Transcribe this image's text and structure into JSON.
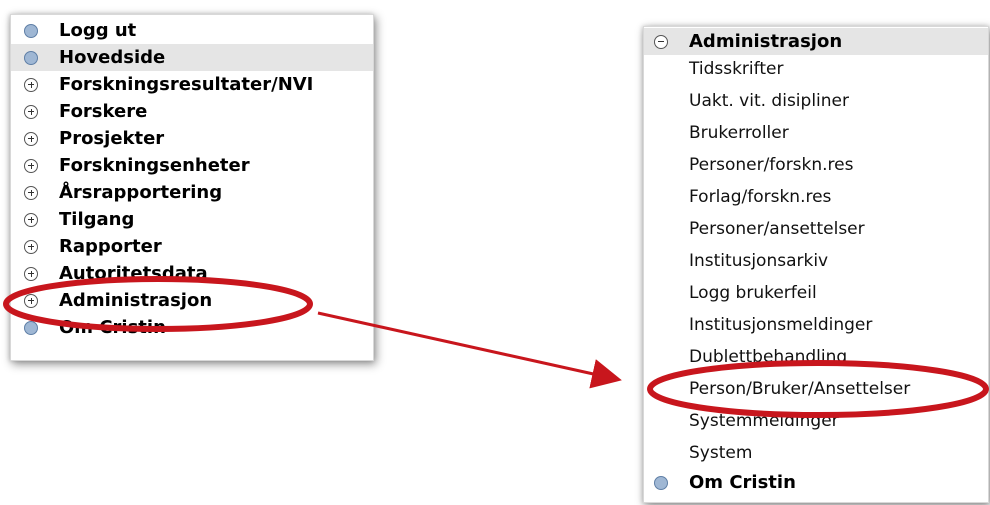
{
  "left_menu": {
    "items": [
      {
        "label": "Logg ut",
        "icon": "bullet"
      },
      {
        "label": "Hovedside",
        "icon": "bullet"
      },
      {
        "label": "Forskningsresultater/NVI",
        "icon": "plus"
      },
      {
        "label": "Forskere",
        "icon": "plus"
      },
      {
        "label": "Prosjekter",
        "icon": "plus"
      },
      {
        "label": "Forskningsenheter",
        "icon": "plus"
      },
      {
        "label": "Årsrapportering",
        "icon": "plus"
      },
      {
        "label": "Tilgang",
        "icon": "plus"
      },
      {
        "label": "Rapporter",
        "icon": "plus"
      },
      {
        "label": "Autoritetsdata",
        "icon": "plus"
      },
      {
        "label": "Administrasjon",
        "icon": "plus"
      },
      {
        "label": "Om Cristin",
        "icon": "bullet"
      }
    ]
  },
  "right_menu": {
    "header": "Administrasjon",
    "subitems": [
      "Tidsskrifter",
      "Uakt. vit. disipliner",
      "Brukerroller",
      "Personer/forskn.res",
      "Forlag/forskn.res",
      "Personer/ansettelser",
      "Institusjonsarkiv",
      "Logg brukerfeil",
      "Institusjonsmeldinger",
      "Dublettbehandling",
      "Person/Bruker/Ansettelser",
      "Systemmeldinger",
      "System"
    ],
    "footer": "Om Cristin"
  },
  "colors": {
    "highlight_bg": "#e5e5e5",
    "bullet_fill": "#9fb7d4",
    "annotation_red": "#c8161d"
  }
}
